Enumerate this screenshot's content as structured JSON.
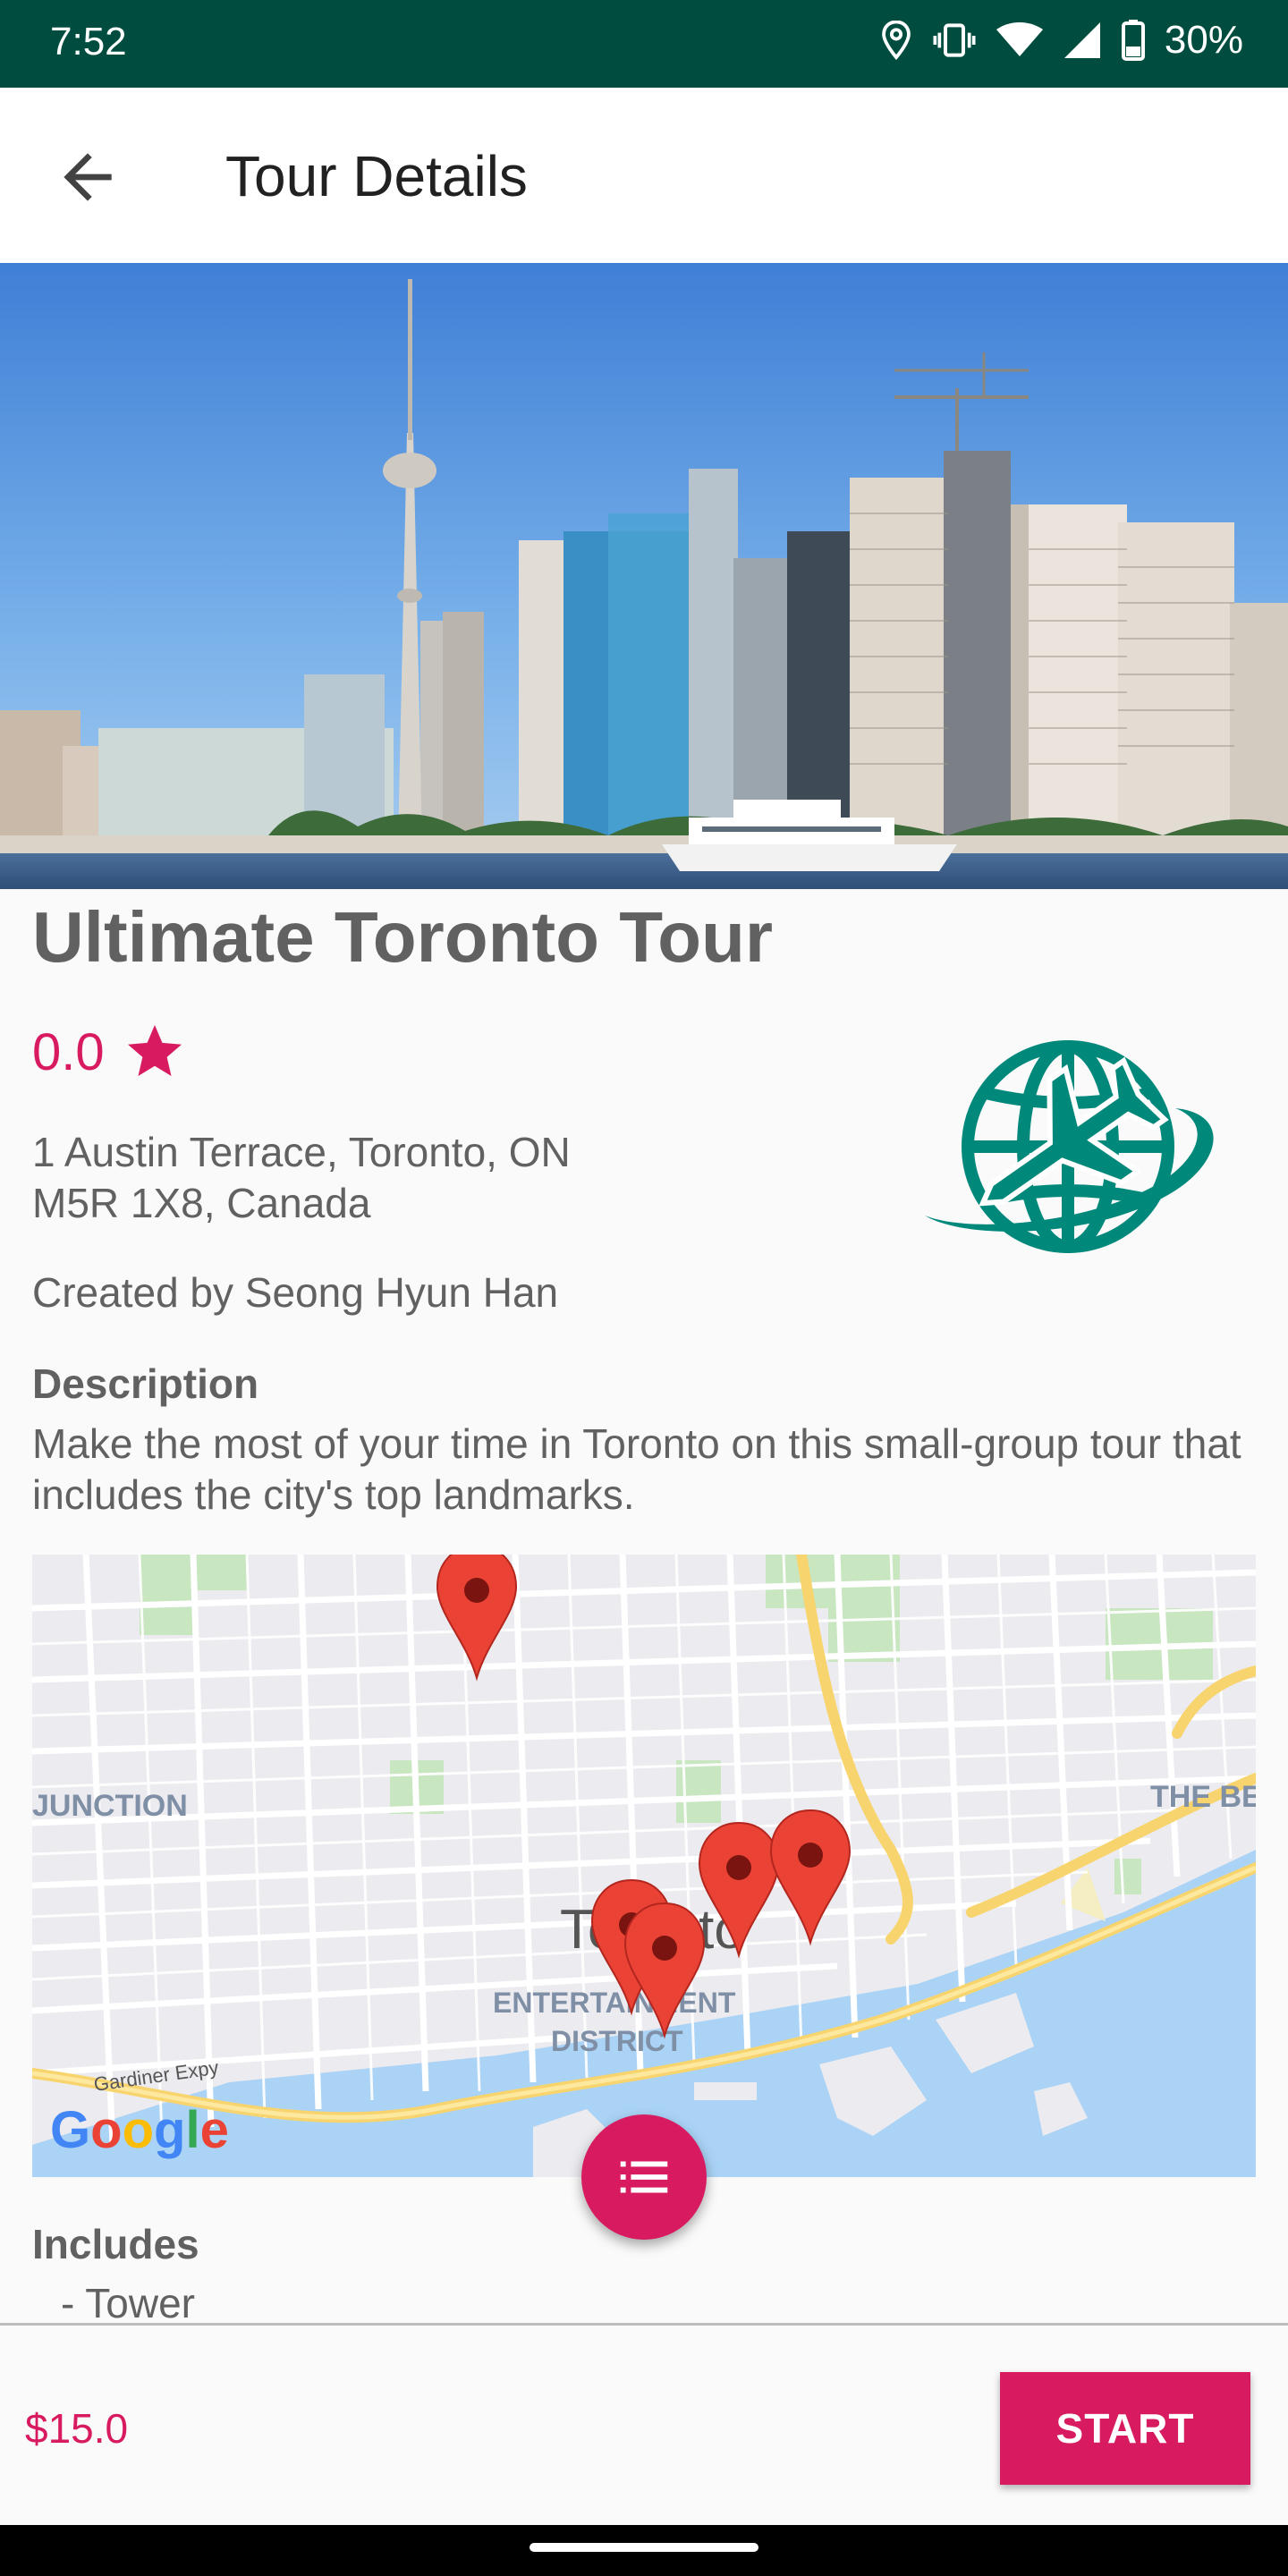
{
  "status_bar": {
    "time": "7:52",
    "battery": "30%",
    "icons": [
      "location-icon",
      "vibrate-icon",
      "wifi-icon",
      "signal-icon",
      "battery-icon"
    ]
  },
  "app_bar": {
    "title": "Tour Details",
    "back_icon": "arrow-back-icon"
  },
  "tour": {
    "name": "Ultimate Toronto Tour",
    "rating": "0.0",
    "rating_icon": "star-icon",
    "address_line1": "1 Austin Terrace, Toronto, ON",
    "address_line2": "M5R 1X8, Canada",
    "creator": "Created by Seong Hyun Han",
    "description_heading": "Description",
    "description": "Make the most of your time in Toronto on this small-group tour that includes the city's top landmarks.",
    "logo_icon": "globe-airplane-icon",
    "includes_heading": "Includes",
    "includes": [
      "- Tower"
    ]
  },
  "map": {
    "labels": {
      "junction": "JUNCTION",
      "the_beaches": "THE BE",
      "city": "Toronto",
      "district_line1": "ENTERTAINMENT",
      "district_line2": "DISTRICT",
      "road": "Gardiner Expy"
    },
    "google": "Google",
    "markers": 5
  },
  "fab": {
    "icon": "list-icon"
  },
  "footer": {
    "price": "$15.0",
    "start_label": "START"
  },
  "colors": {
    "accent": "#d81b60",
    "status_bar": "#004d40",
    "logo": "#00897b",
    "marker": "#ea4335"
  }
}
